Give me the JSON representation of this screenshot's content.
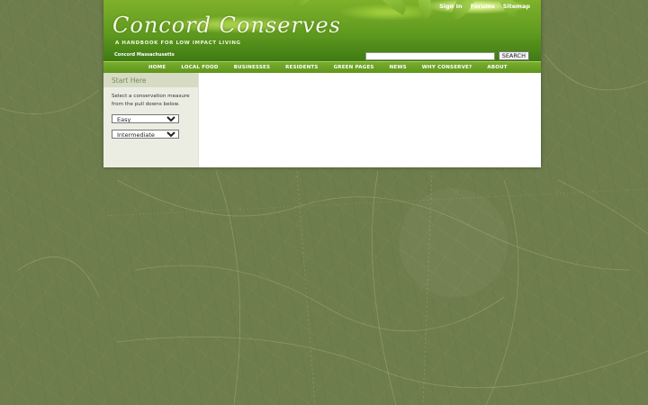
{
  "header": {
    "site_title": "Concord Conserves",
    "tagline": "A HANDBOOK FOR LOW IMPACT LIVING",
    "location": "Concord Massachusetts",
    "top_links": [
      "Sign In",
      "Forums",
      "Sitemap"
    ],
    "search": {
      "placeholder": "",
      "value": "",
      "button_label": "SEARCH"
    }
  },
  "nav": {
    "items": [
      "HOME",
      "LOCAL FOOD",
      "BUSINESSES",
      "RESIDENTS",
      "GREEN PAGES",
      "NEWS",
      "WHY CONSERVE?",
      "ABOUT"
    ]
  },
  "sidebar": {
    "title": "Start Here",
    "instructions": "Select a conservation measure from the pull downs below.",
    "select_1": "Easy",
    "select_2": "Intermediate"
  },
  "colors": {
    "background": "#6e7d4c",
    "nav_green": "#6ca326",
    "sidebar_bg": "#ebede3",
    "sidebar_title_text": "#7b8a5c"
  }
}
